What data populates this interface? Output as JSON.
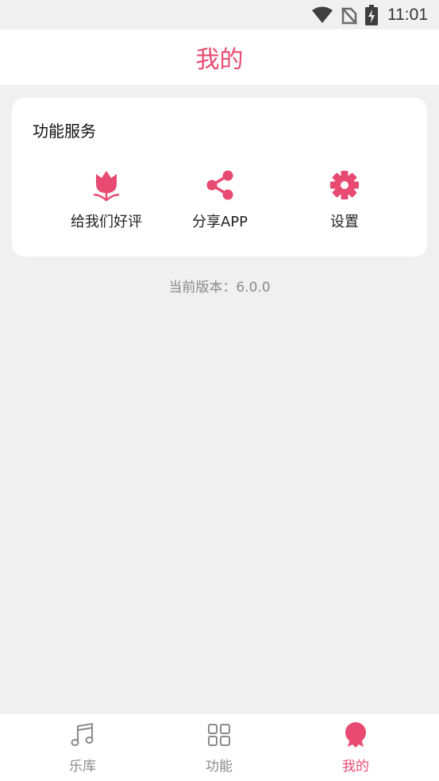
{
  "status_bar": {
    "time": "11:01"
  },
  "header": {
    "title": "我的"
  },
  "services_card": {
    "title": "功能服务",
    "items": [
      {
        "label": "给我们好评",
        "icon": "tulip-icon"
      },
      {
        "label": "分享APP",
        "icon": "share-icon"
      },
      {
        "label": "设置",
        "icon": "gear-icon"
      }
    ]
  },
  "version": {
    "text": "当前版本：6.0.0"
  },
  "tabs": [
    {
      "label": "乐库",
      "icon": "music-note-icon",
      "active": false
    },
    {
      "label": "功能",
      "icon": "grid-icon",
      "active": false
    },
    {
      "label": "我的",
      "icon": "badge-icon",
      "active": true
    }
  ],
  "colors": {
    "accent": "#e84a72",
    "background": "#f0f0f0",
    "card": "#ffffff",
    "muted": "#8a8a8a"
  }
}
